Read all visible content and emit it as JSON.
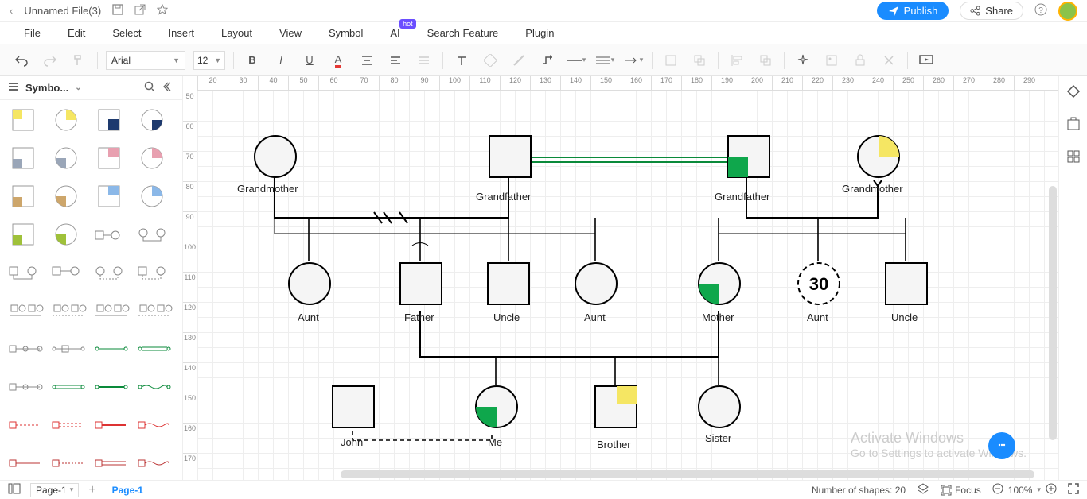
{
  "header": {
    "filename": "Unnamed File(3)",
    "publish_label": "Publish",
    "share_label": "Share"
  },
  "menubar": {
    "file": "File",
    "edit": "Edit",
    "select": "Select",
    "insert": "Insert",
    "layout": "Layout",
    "view": "View",
    "symbol": "Symbol",
    "ai": "AI",
    "ai_badge": "hot",
    "search_feature": "Search Feature",
    "plugin": "Plugin"
  },
  "toolbar": {
    "font": "Arial",
    "font_size": "12"
  },
  "sidebar": {
    "title": "Symbo..."
  },
  "ruler_h": [
    "20",
    "30",
    "40",
    "50",
    "60",
    "70",
    "80",
    "90",
    "100",
    "110",
    "120",
    "130",
    "140",
    "150",
    "160",
    "170",
    "180",
    "190",
    "200",
    "210",
    "220",
    "230",
    "240",
    "250",
    "260",
    "270",
    "280",
    "290"
  ],
  "ruler_v": [
    "50",
    "60",
    "70",
    "80",
    "90",
    "100",
    "110",
    "120",
    "130",
    "140",
    "150",
    "160",
    "170"
  ],
  "canvas": {
    "nodes": {
      "grandmother1": "Grandmother",
      "grandfather1": "Grandfather",
      "grandfather2": "Grandfather",
      "grandmother2": "Grandmother",
      "aunt1": "Aunt",
      "father": "Father",
      "uncle1": "Uncle",
      "aunt2": "Aunt",
      "mother": "Mother",
      "aunt3": "Aunt",
      "aunt3_age": "30",
      "uncle2": "Uncle",
      "john": "John",
      "me": "Me",
      "brother": "Brother",
      "sister": "Sister"
    }
  },
  "footer": {
    "page_select": "Page-1",
    "page_tab": "Page-1",
    "shape_count": "Number of shapes: 20",
    "focus": "Focus",
    "zoom": "100%"
  },
  "watermark": {
    "line1": "Activate Windows",
    "line2": "Go to Settings to activate Windows."
  }
}
